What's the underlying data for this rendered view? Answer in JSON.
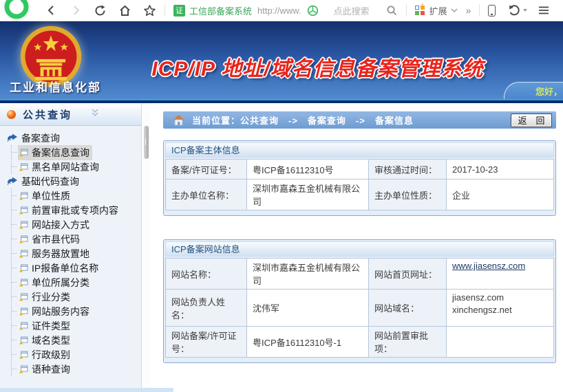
{
  "browser": {
    "badge": "证",
    "site_name": "工信部备案系统",
    "url_text": "http://www.",
    "search_placeholder": "点此搜索",
    "extensions_label": "扩展",
    "more_label": "»"
  },
  "header": {
    "system_title": "ICP/IP 地址/域名信息备案管理系统",
    "ministry_name": "工业和信息化部",
    "greeting": "您好，"
  },
  "sidebar": {
    "panel_title": "公共查询",
    "groups": [
      {
        "label": "备案查询",
        "children": [
          "备案信息查询",
          "黑名单网站查询"
        ]
      },
      {
        "label": "基础代码查询",
        "children": [
          "单位性质",
          "前置审批或专项内容",
          "网站接入方式",
          "省市县代码",
          "服务器放置地",
          "IP报备单位名称",
          "单位所属分类",
          "行业分类",
          "网站服务内容",
          "证件类型",
          "域名类型",
          "行政级别",
          "语种查询"
        ]
      }
    ],
    "selected_item": "备案信息查询"
  },
  "breadcrumb": {
    "location_text": "当前位置：公共查询　->　备案查询　->　备案信息",
    "back_label": "返　回"
  },
  "subject_table": {
    "title": "ICP备案主体信息",
    "rows": [
      {
        "l1": "备案/许可证号：",
        "v1": "粤ICP备16112310号",
        "l2": "审核通过时间：",
        "v2": "2017-10-23"
      },
      {
        "l1": "主办单位名称：",
        "v1": "深圳市嘉森五金机械有限公司",
        "l2": "主办单位性质：",
        "v2": "企业"
      }
    ]
  },
  "website_table": {
    "title": "ICP备案网站信息",
    "rows": [
      {
        "l1": "网站名称：",
        "v1": "深圳市嘉森五金机械有限公司",
        "l2": "网站首页网址：",
        "v2": "www.jiasensz.com"
      },
      {
        "l1": "网站负责人姓名：",
        "v1": "沈伟军",
        "l2": "网站域名：",
        "v2a": "jiasensz.com",
        "v2b": "xinchengsz.net"
      },
      {
        "l1": "网站备案/许可证号：",
        "v1": "粤ICP备16112310号-1",
        "l2": "网站前置审批项：",
        "v2": ""
      }
    ]
  },
  "colors": {
    "title_red": "#e8241c",
    "banner_top": "#14306c",
    "banner_bottom": "#5189cd",
    "link": "#1f3864",
    "greeting_yellow": "#d6e65b"
  }
}
